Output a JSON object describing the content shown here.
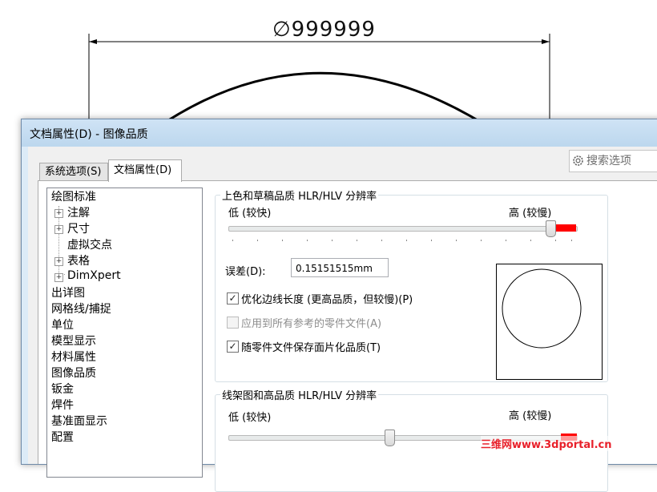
{
  "drawing": {
    "dimension_text": "∅999999"
  },
  "dialog": {
    "title": "文档属性(D) - 图像品质",
    "tabs": [
      {
        "label": "系统选项(S)",
        "active": false
      },
      {
        "label": "文档属性(D)",
        "active": true
      }
    ],
    "search_placeholder": "搜索选项"
  },
  "tree": {
    "items": [
      {
        "label": "绘图标准",
        "level": 0,
        "expander": ""
      },
      {
        "label": "注解",
        "level": 1,
        "expander": "+"
      },
      {
        "label": "尺寸",
        "level": 1,
        "expander": "+"
      },
      {
        "label": "虚拟交点",
        "level": 1,
        "expander": ""
      },
      {
        "label": "表格",
        "level": 1,
        "expander": "+"
      },
      {
        "label": "DimXpert",
        "level": 1,
        "expander": "+"
      },
      {
        "label": "出详图",
        "level": 0,
        "expander": ""
      },
      {
        "label": "网格线/捕捉",
        "level": 0,
        "expander": ""
      },
      {
        "label": "单位",
        "level": 0,
        "expander": ""
      },
      {
        "label": "模型显示",
        "level": 0,
        "expander": ""
      },
      {
        "label": "材料属性",
        "level": 0,
        "expander": ""
      },
      {
        "label": "图像品质",
        "level": 0,
        "expander": ""
      },
      {
        "label": "钣金",
        "level": 0,
        "expander": ""
      },
      {
        "label": "焊件",
        "level": 0,
        "expander": ""
      },
      {
        "label": "基准面显示",
        "level": 0,
        "expander": ""
      },
      {
        "label": "配置",
        "level": 0,
        "expander": ""
      }
    ]
  },
  "shaded": {
    "title": "上色和草稿品质 HLR/HLV 分辨率",
    "low_label": "低 (较快)",
    "high_label": "高 (较慢)",
    "slider_level": 1.0,
    "deviation_label": "误差(D):",
    "deviation_value": "0.15151515mm",
    "options": [
      {
        "label": "优化边线长度 (更高品质，但较慢)(P)",
        "checked": true,
        "enabled": true
      },
      {
        "label": "应用到所有参考的零件文件(A)",
        "checked": false,
        "enabled": false
      },
      {
        "label": "随零件文件保存面片化品质(T)",
        "checked": true,
        "enabled": true
      }
    ]
  },
  "wireframe": {
    "title": "线架图和高品质 HLR/HLV 分辨率",
    "low_label": "低 (较快)",
    "high_label": "高 (较慢)",
    "slider_level": 0.5
  },
  "watermark": "三维网www.3dportal.cn"
}
